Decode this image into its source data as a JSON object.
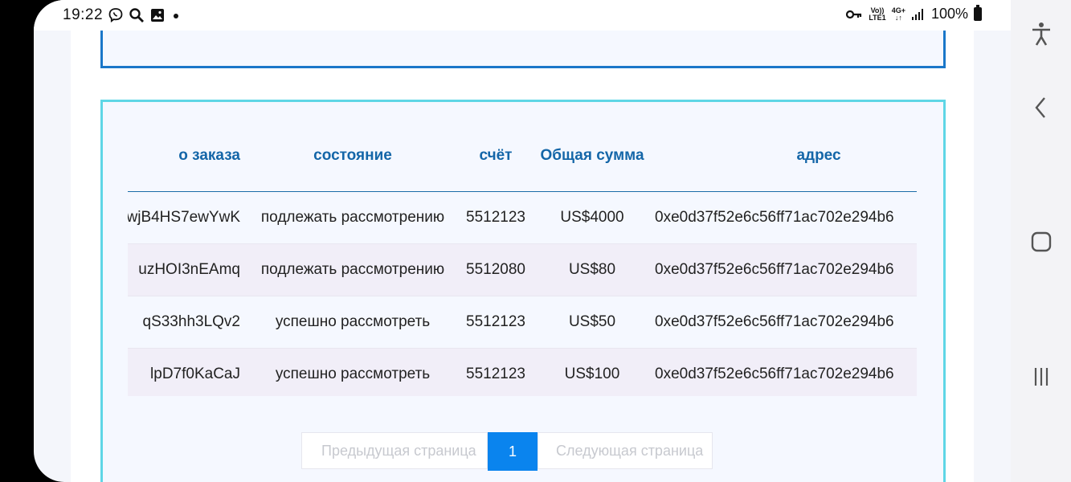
{
  "status_bar": {
    "time": "19:22",
    "network_top": "4G+",
    "volte_top": "Vo))",
    "volte_bottom": "LTE1",
    "battery": "100%"
  },
  "orders_table": {
    "headers": {
      "id": "о заказа",
      "status": "состояние",
      "account": "счёт",
      "total": "Общая сумма",
      "address": "адрес"
    },
    "rows": [
      {
        "id": "wjB4HS7ewYwK",
        "status": "подлежать рассмотрению",
        "account": "5512123",
        "total": "US$4000",
        "address": "0xe0d37f52e6c56ff71ac702e294b6"
      },
      {
        "id": "uzHOI3nEAmq",
        "status": "подлежать рассмотрению",
        "account": "5512080",
        "total": "US$80",
        "address": "0xe0d37f52e6c56ff71ac702e294b6"
      },
      {
        "id": "qS33hh3LQv2",
        "status": "успешно рассмотреть",
        "account": "5512123",
        "total": "US$50",
        "address": "0xe0d37f52e6c56ff71ac702e294b6"
      },
      {
        "id": "lpD7f0KaCaJ",
        "status": "успешно рассмотреть",
        "account": "5512123",
        "total": "US$100",
        "address": "0xe0d37f52e6c56ff71ac702e294b6"
      }
    ]
  },
  "pagination": {
    "prev_label": "Предыдущая страница",
    "current_page": "1",
    "next_label": "Следующая страница"
  },
  "colors": {
    "accent": "#0a84ee",
    "header_text": "#1466a8",
    "card_border": "#5fd6e6"
  }
}
